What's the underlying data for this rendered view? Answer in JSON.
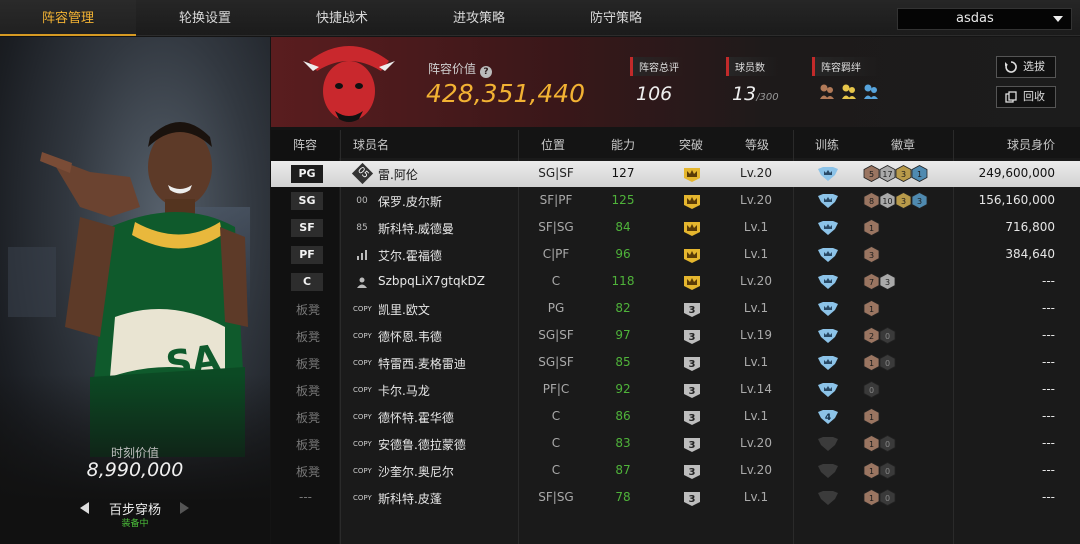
{
  "nav": {
    "tabs": [
      "阵容管理",
      "轮换设置",
      "快捷战术",
      "进攻策略",
      "防守策略"
    ],
    "active_tab": 0,
    "account": "asdas"
  },
  "left_panel": {
    "value_label": "时刻价值",
    "value": "8,990,000",
    "skill_name": "百步穿杨",
    "skill_status": "装备中"
  },
  "header": {
    "team_logo_text": "CHICAGO BULLS",
    "value_label": "阵容价值",
    "value": "428,351,440",
    "rating_label": "阵容总评",
    "rating": "106",
    "count_label": "球员数",
    "count": "13",
    "count_max": "/300",
    "bond_label": "阵容羁绊",
    "bond_icons": [
      "bond-bronze-icon",
      "bond-gold-icon",
      "bond-blue-icon"
    ],
    "buttons": {
      "select": "选拔",
      "recycle": "回收"
    }
  },
  "table": {
    "headers": [
      "阵容",
      "球员名",
      "位置",
      "能力",
      "突破",
      "等级",
      "训练",
      "徽章",
      "球员身价"
    ],
    "rows": [
      {
        "lineup": "PG",
        "starter": true,
        "num": "05",
        "name": "雷.阿伦",
        "pos": "SG|SF",
        "ability": "127",
        "ability_white": true,
        "breakthrough": "crown",
        "level": "Lv.20",
        "training": "full",
        "badges": [
          "5",
          "17",
          "3",
          "1"
        ],
        "badge_colors": [
          "bronze",
          "silver",
          "gold",
          "blue"
        ],
        "worth": "249,600,000",
        "selected": true
      },
      {
        "lineup": "SG",
        "starter": true,
        "num": "00",
        "name": "保罗.皮尔斯",
        "pos": "SF|PF",
        "ability": "125",
        "ability_white": false,
        "breakthrough": "crown",
        "level": "Lv.20",
        "training": "full",
        "badges": [
          "8",
          "10",
          "3",
          "3"
        ],
        "badge_colors": [
          "bronze",
          "silver",
          "gold",
          "blue"
        ],
        "worth": "156,160,000"
      },
      {
        "lineup": "SF",
        "starter": true,
        "num": "85",
        "name": "斯科特.威德曼",
        "pos": "SF|SG",
        "ability": "84",
        "ability_white": false,
        "breakthrough": "crown",
        "level": "Lv.1",
        "training": "full",
        "badges": [
          "1"
        ],
        "badge_colors": [
          "bronze"
        ],
        "worth": "716,800"
      },
      {
        "lineup": "PF",
        "starter": true,
        "num": "signal",
        "name": "艾尔.霍福德",
        "pos": "C|PF",
        "ability": "96",
        "ability_white": false,
        "breakthrough": "crown",
        "level": "Lv.1",
        "training": "full",
        "badges": [
          "3"
        ],
        "badge_colors": [
          "bronze"
        ],
        "worth": "384,640"
      },
      {
        "lineup": "C",
        "starter": true,
        "num": "person",
        "name": "SzbpqLiX7gtqkDZ",
        "pos": "C",
        "ability": "118",
        "ability_white": false,
        "breakthrough": "crown",
        "level": "Lv.20",
        "training": "full",
        "badges": [
          "7",
          "3"
        ],
        "badge_colors": [
          "bronze",
          "silver"
        ],
        "worth": "---"
      },
      {
        "lineup": "板凳",
        "starter": false,
        "num": "COPY",
        "name": "凯里.欧文",
        "pos": "PG",
        "ability": "82",
        "ability_white": false,
        "breakthrough": "3",
        "level": "Lv.1",
        "training": "full",
        "badges": [
          "1"
        ],
        "badge_colors": [
          "bronze"
        ],
        "worth": "---"
      },
      {
        "lineup": "板凳",
        "starter": false,
        "num": "COPY",
        "name": "德怀恩.韦德",
        "pos": "SG|SF",
        "ability": "97",
        "ability_white": false,
        "breakthrough": "3",
        "level": "Lv.19",
        "training": "full",
        "badges": [
          "2",
          "0"
        ],
        "badge_colors": [
          "bronze",
          "dark"
        ],
        "worth": "---"
      },
      {
        "lineup": "板凳",
        "starter": false,
        "num": "COPY",
        "name": "特雷西.麦格雷迪",
        "pos": "SG|SF",
        "ability": "85",
        "ability_white": false,
        "breakthrough": "3",
        "level": "Lv.1",
        "training": "full",
        "badges": [
          "1",
          "0"
        ],
        "badge_colors": [
          "bronze",
          "dark"
        ],
        "worth": "---"
      },
      {
        "lineup": "板凳",
        "starter": false,
        "num": "COPY",
        "name": "卡尔.马龙",
        "pos": "PF|C",
        "ability": "92",
        "ability_white": false,
        "breakthrough": "3",
        "level": "Lv.14",
        "training": "full",
        "badges": [
          "0"
        ],
        "badge_colors": [
          "dark"
        ],
        "worth": "---"
      },
      {
        "lineup": "板凳",
        "starter": false,
        "num": "COPY",
        "name": "德怀特.霍华德",
        "pos": "C",
        "ability": "86",
        "ability_white": false,
        "breakthrough": "3",
        "level": "Lv.1",
        "training": "4",
        "badges": [
          "1"
        ],
        "badge_colors": [
          "bronze"
        ],
        "worth": "---"
      },
      {
        "lineup": "板凳",
        "starter": false,
        "num": "COPY",
        "name": "安德鲁.德拉蒙德",
        "pos": "C",
        "ability": "83",
        "ability_white": false,
        "breakthrough": "3",
        "level": "Lv.20",
        "training": "empty",
        "badges": [
          "1",
          "0"
        ],
        "badge_colors": [
          "bronze",
          "dark"
        ],
        "worth": "---"
      },
      {
        "lineup": "板凳",
        "starter": false,
        "num": "COPY",
        "name": "沙奎尔.奥尼尔",
        "pos": "C",
        "ability": "87",
        "ability_white": false,
        "breakthrough": "3",
        "level": "Lv.20",
        "training": "empty",
        "badges": [
          "1",
          "0"
        ],
        "badge_colors": [
          "bronze",
          "dark"
        ],
        "worth": "---"
      },
      {
        "lineup": "---",
        "starter": false,
        "num": "COPY",
        "name": "斯科特.皮蓬",
        "pos": "SF|SG",
        "ability": "78",
        "ability_white": false,
        "breakthrough": "3",
        "level": "Lv.1",
        "training": "empty",
        "badges": [
          "1",
          "0"
        ],
        "badge_colors": [
          "bronze",
          "dark"
        ],
        "worth": "---"
      }
    ]
  },
  "colors": {
    "accent": "#f2b233",
    "green": "#4fb33a",
    "red_marker": "#c22a2a",
    "bronze": "#9a7561",
    "silver": "#a9a9a9",
    "gold": "#b89a4a",
    "blue": "#4f8ab0"
  }
}
